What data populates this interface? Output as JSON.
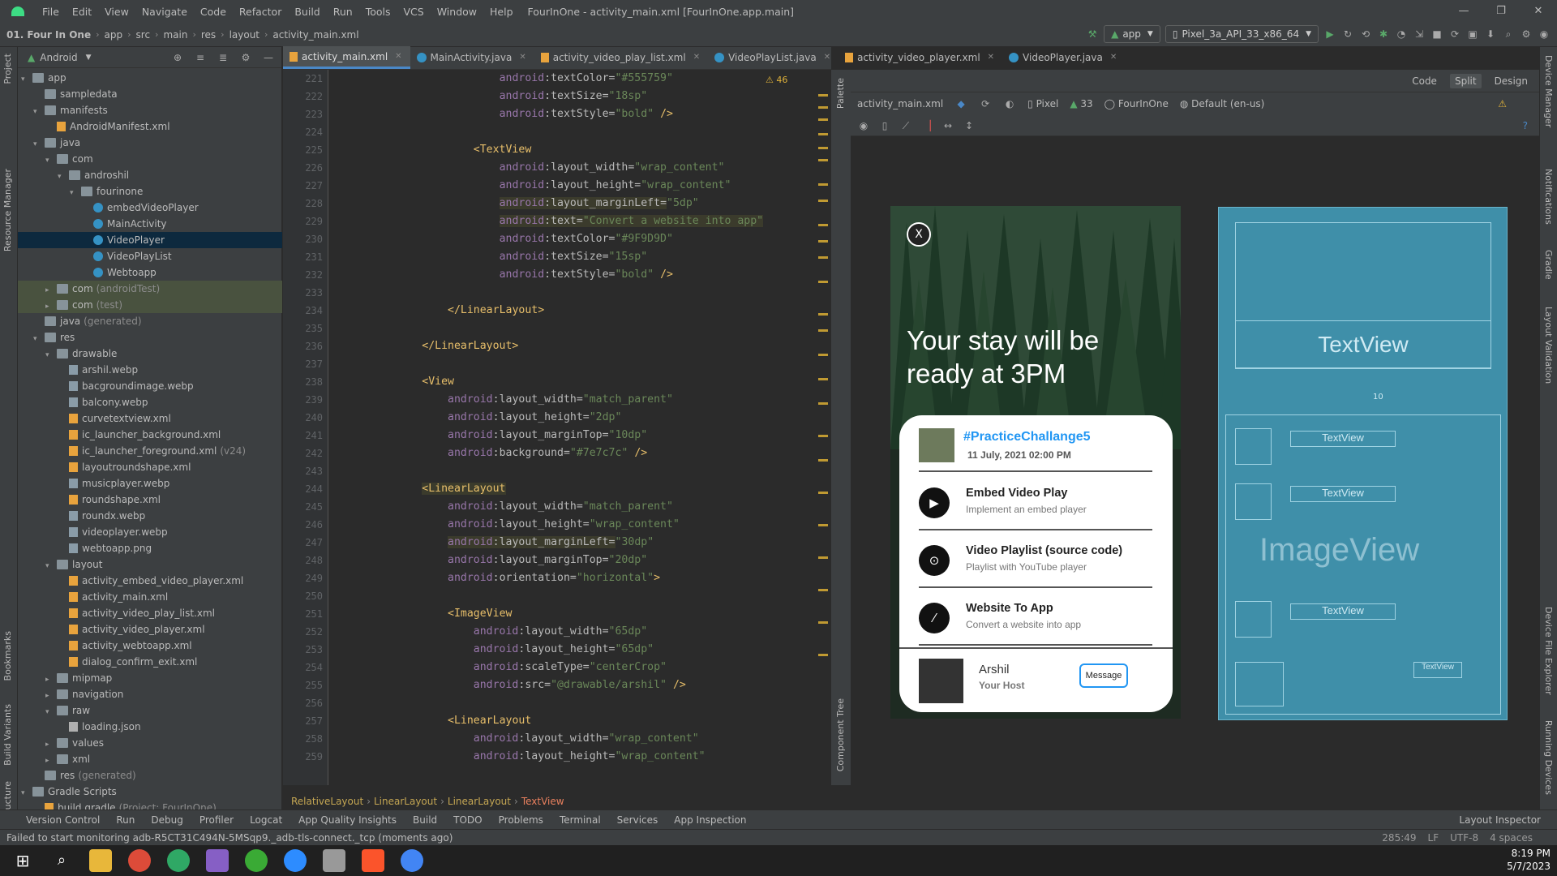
{
  "window": {
    "title": "FourInOne - activity_main.xml [FourInOne.app.main]",
    "menu": [
      "File",
      "Edit",
      "View",
      "Navigate",
      "Code",
      "Refactor",
      "Build",
      "Run",
      "Tools",
      "VCS",
      "Window",
      "Help"
    ],
    "buttons": [
      "—",
      "❐",
      "✕"
    ]
  },
  "nav": {
    "breadcrumb": [
      "01. Four In One",
      "app",
      "src",
      "main",
      "res",
      "layout",
      "activity_main.xml"
    ],
    "run_config": "app",
    "device": "Pixel_3a_API_33_x86_64"
  },
  "project": {
    "view": "Android",
    "tree": [
      {
        "label": "app",
        "depth": 0,
        "arrow": "down",
        "type": "folder"
      },
      {
        "label": "sampledata",
        "depth": 1,
        "arrow": "",
        "type": "folder"
      },
      {
        "label": "manifests",
        "depth": 1,
        "arrow": "down",
        "type": "folder"
      },
      {
        "label": "AndroidManifest.xml",
        "depth": 2,
        "arrow": "",
        "type": "xml"
      },
      {
        "label": "java",
        "depth": 1,
        "arrow": "down",
        "type": "folder"
      },
      {
        "label": "com",
        "depth": 2,
        "arrow": "down",
        "type": "folder"
      },
      {
        "label": "androshil",
        "depth": 3,
        "arrow": "down",
        "type": "folder"
      },
      {
        "label": "fourinone",
        "depth": 4,
        "arrow": "down",
        "type": "folder"
      },
      {
        "label": "embedVideoPlayer",
        "depth": 5,
        "arrow": "",
        "type": "class"
      },
      {
        "label": "MainActivity",
        "depth": 5,
        "arrow": "",
        "type": "class"
      },
      {
        "label": "VideoPlayer",
        "depth": 5,
        "arrow": "",
        "type": "class",
        "selected": true
      },
      {
        "label": "VideoPlayList",
        "depth": 5,
        "arrow": "",
        "type": "class"
      },
      {
        "label": "Webtoapp",
        "depth": 5,
        "arrow": "",
        "type": "class"
      },
      {
        "label": "com",
        "suffix": "(androidTest)",
        "depth": 2,
        "arrow": "right",
        "type": "folder",
        "gen": true
      },
      {
        "label": "com",
        "suffix": "(test)",
        "depth": 2,
        "arrow": "right",
        "type": "folder",
        "gen": true
      },
      {
        "label": "java",
        "suffix": "(generated)",
        "depth": 1,
        "arrow": "",
        "type": "folder"
      },
      {
        "label": "res",
        "depth": 1,
        "arrow": "down",
        "type": "folder"
      },
      {
        "label": "drawable",
        "depth": 2,
        "arrow": "down",
        "type": "folder"
      },
      {
        "label": "arshil.webp",
        "depth": 3,
        "arrow": "",
        "type": "img"
      },
      {
        "label": "bacgroundimage.webp",
        "depth": 3,
        "arrow": "",
        "type": "img"
      },
      {
        "label": "balcony.webp",
        "depth": 3,
        "arrow": "",
        "type": "img"
      },
      {
        "label": "curvetextview.xml",
        "depth": 3,
        "arrow": "",
        "type": "xml"
      },
      {
        "label": "ic_launcher_background.xml",
        "depth": 3,
        "arrow": "",
        "type": "xml"
      },
      {
        "label": "ic_launcher_foreground.xml",
        "suffix": "(v24)",
        "depth": 3,
        "arrow": "",
        "type": "xml"
      },
      {
        "label": "layoutroundshape.xml",
        "depth": 3,
        "arrow": "",
        "type": "xml"
      },
      {
        "label": "musicplayer.webp",
        "depth": 3,
        "arrow": "",
        "type": "img"
      },
      {
        "label": "roundshape.xml",
        "depth": 3,
        "arrow": "",
        "type": "xml"
      },
      {
        "label": "roundx.webp",
        "depth": 3,
        "arrow": "",
        "type": "img"
      },
      {
        "label": "videoplayer.webp",
        "depth": 3,
        "arrow": "",
        "type": "img"
      },
      {
        "label": "webtoapp.png",
        "depth": 3,
        "arrow": "",
        "type": "img"
      },
      {
        "label": "layout",
        "depth": 2,
        "arrow": "down",
        "type": "folder"
      },
      {
        "label": "activity_embed_video_player.xml",
        "depth": 3,
        "arrow": "",
        "type": "xml"
      },
      {
        "label": "activity_main.xml",
        "depth": 3,
        "arrow": "",
        "type": "xml"
      },
      {
        "label": "activity_video_play_list.xml",
        "depth": 3,
        "arrow": "",
        "type": "xml"
      },
      {
        "label": "activity_video_player.xml",
        "depth": 3,
        "arrow": "",
        "type": "xml"
      },
      {
        "label": "activity_webtoapp.xml",
        "depth": 3,
        "arrow": "",
        "type": "xml"
      },
      {
        "label": "dialog_confirm_exit.xml",
        "depth": 3,
        "arrow": "",
        "type": "xml"
      },
      {
        "label": "mipmap",
        "depth": 2,
        "arrow": "right",
        "type": "folder"
      },
      {
        "label": "navigation",
        "depth": 2,
        "arrow": "right",
        "type": "folder"
      },
      {
        "label": "raw",
        "depth": 2,
        "arrow": "down",
        "type": "folder"
      },
      {
        "label": "loading.json",
        "depth": 3,
        "arrow": "",
        "type": "json"
      },
      {
        "label": "values",
        "depth": 2,
        "arrow": "right",
        "type": "folder"
      },
      {
        "label": "xml",
        "depth": 2,
        "arrow": "right",
        "type": "folder"
      },
      {
        "label": "res",
        "suffix": "(generated)",
        "depth": 1,
        "arrow": "",
        "type": "folder"
      },
      {
        "label": "Gradle Scripts",
        "depth": 0,
        "arrow": "down",
        "type": "folder"
      },
      {
        "label": "build.gradle",
        "suffix": "(Project: FourInOne)",
        "depth": 1,
        "arrow": "",
        "type": "xml"
      }
    ]
  },
  "tabs": [
    {
      "label": "activity_main.xml",
      "kind": "xml",
      "active": true
    },
    {
      "label": "MainActivity.java",
      "kind": "class"
    },
    {
      "label": "activity_video_play_list.xml",
      "kind": "xml"
    },
    {
      "label": "VideoPlayList.java",
      "kind": "class"
    },
    {
      "label": "activity_video_player.xml",
      "kind": "xml"
    },
    {
      "label": "VideoPlayer.java",
      "kind": "class"
    }
  ],
  "editor": {
    "warning_count": "46",
    "lines": [
      {
        "n": "221",
        "indent": 6,
        "tokens": [
          [
            "ns",
            "android"
          ],
          [
            "at",
            ":textColor="
          ],
          [
            "str",
            "\"#555759\""
          ]
        ]
      },
      {
        "n": "222",
        "indent": 6,
        "tokens": [
          [
            "ns",
            "android"
          ],
          [
            "at",
            ":textSize="
          ],
          [
            "str",
            "\"18sp\""
          ]
        ]
      },
      {
        "n": "223",
        "indent": 6,
        "tokens": [
          [
            "ns",
            "android"
          ],
          [
            "at",
            ":textStyle="
          ],
          [
            "str",
            "\"bold\""
          ],
          [
            "tag",
            " />"
          ]
        ]
      },
      {
        "n": "224",
        "indent": 0,
        "tokens": []
      },
      {
        "n": "225",
        "indent": 5,
        "tokens": [
          [
            "tag",
            "<TextView"
          ]
        ]
      },
      {
        "n": "226",
        "indent": 6,
        "tokens": [
          [
            "ns",
            "android"
          ],
          [
            "at",
            ":layout_width="
          ],
          [
            "str",
            "\"wrap_content\""
          ]
        ]
      },
      {
        "n": "227",
        "indent": 6,
        "tokens": [
          [
            "ns",
            "android"
          ],
          [
            "at",
            ":layout_height="
          ],
          [
            "str",
            "\"wrap_content\""
          ]
        ]
      },
      {
        "n": "228",
        "indent": 6,
        "hl": true,
        "tokens": [
          [
            "ns",
            "android"
          ],
          [
            "at",
            ":layout_marginLeft"
          ],
          [
            "at",
            "="
          ],
          [
            "str",
            "\"5dp\""
          ]
        ]
      },
      {
        "n": "229",
        "indent": 6,
        "hl": true,
        "tokens": [
          [
            "ns",
            "android"
          ],
          [
            "at",
            ":text="
          ],
          [
            "str",
            "\"Convert a website into app\""
          ]
        ]
      },
      {
        "n": "230",
        "indent": 6,
        "tokens": [
          [
            "ns",
            "android"
          ],
          [
            "at",
            ":textColor="
          ],
          [
            "str",
            "\"#9F9D9D\""
          ]
        ]
      },
      {
        "n": "231",
        "indent": 6,
        "tokens": [
          [
            "ns",
            "android"
          ],
          [
            "at",
            ":textSize="
          ],
          [
            "str",
            "\"15sp\""
          ]
        ]
      },
      {
        "n": "232",
        "indent": 6,
        "tokens": [
          [
            "ns",
            "android"
          ],
          [
            "at",
            ":textStyle="
          ],
          [
            "str",
            "\"bold\""
          ],
          [
            "tag",
            " />"
          ]
        ]
      },
      {
        "n": "233",
        "indent": 0,
        "tokens": []
      },
      {
        "n": "234",
        "indent": 4,
        "tokens": [
          [
            "tag",
            "</LinearLayout>"
          ]
        ]
      },
      {
        "n": "235",
        "indent": 0,
        "tokens": []
      },
      {
        "n": "236",
        "indent": 3,
        "tokens": [
          [
            "tag",
            "</LinearLayout>"
          ]
        ]
      },
      {
        "n": "237",
        "indent": 0,
        "tokens": []
      },
      {
        "n": "238",
        "indent": 3,
        "tokens": [
          [
            "tag",
            "<View"
          ]
        ]
      },
      {
        "n": "239",
        "indent": 4,
        "tokens": [
          [
            "ns",
            "android"
          ],
          [
            "at",
            ":layout_width="
          ],
          [
            "str",
            "\"match_parent\""
          ]
        ]
      },
      {
        "n": "240",
        "indent": 4,
        "tokens": [
          [
            "ns",
            "android"
          ],
          [
            "at",
            ":layout_height="
          ],
          [
            "str",
            "\"2dp\""
          ]
        ]
      },
      {
        "n": "241",
        "indent": 4,
        "tokens": [
          [
            "ns",
            "android"
          ],
          [
            "at",
            ":layout_marginTop="
          ],
          [
            "str",
            "\"10dp\""
          ]
        ]
      },
      {
        "n": "242",
        "indent": 4,
        "tokens": [
          [
            "ns",
            "android"
          ],
          [
            "at",
            ":background="
          ],
          [
            "str",
            "\"#7e7c7c\""
          ],
          [
            "tag",
            " />"
          ]
        ]
      },
      {
        "n": "243",
        "indent": 0,
        "tokens": []
      },
      {
        "n": "244",
        "indent": 3,
        "hl": true,
        "tokens": [
          [
            "tag",
            "<LinearLayout"
          ]
        ]
      },
      {
        "n": "245",
        "indent": 4,
        "tokens": [
          [
            "ns",
            "android"
          ],
          [
            "at",
            ":layout_width="
          ],
          [
            "str",
            "\"match_parent\""
          ]
        ]
      },
      {
        "n": "246",
        "indent": 4,
        "tokens": [
          [
            "ns",
            "android"
          ],
          [
            "at",
            ":layout_height="
          ],
          [
            "str",
            "\"wrap_content\""
          ]
        ]
      },
      {
        "n": "247",
        "indent": 4,
        "hl": true,
        "tokens": [
          [
            "ns",
            "android"
          ],
          [
            "at",
            ":layout_marginLeft"
          ],
          [
            "at",
            "="
          ],
          [
            "str",
            "\"30dp\""
          ]
        ]
      },
      {
        "n": "248",
        "indent": 4,
        "tokens": [
          [
            "ns",
            "android"
          ],
          [
            "at",
            ":layout_marginTop="
          ],
          [
            "str",
            "\"20dp\""
          ]
        ]
      },
      {
        "n": "249",
        "indent": 4,
        "tokens": [
          [
            "ns",
            "android"
          ],
          [
            "at",
            ":orientation="
          ],
          [
            "str",
            "\"horizontal\""
          ],
          [
            "tag",
            ">"
          ]
        ]
      },
      {
        "n": "250",
        "indent": 0,
        "tokens": []
      },
      {
        "n": "251",
        "indent": 4,
        "tokens": [
          [
            "tag",
            "<ImageView"
          ]
        ]
      },
      {
        "n": "252",
        "indent": 5,
        "tokens": [
          [
            "ns",
            "android"
          ],
          [
            "at",
            ":layout_width="
          ],
          [
            "str",
            "\"65dp\""
          ]
        ]
      },
      {
        "n": "253",
        "indent": 5,
        "tokens": [
          [
            "ns",
            "android"
          ],
          [
            "at",
            ":layout_height="
          ],
          [
            "str",
            "\"65dp\""
          ]
        ]
      },
      {
        "n": "254",
        "indent": 5,
        "tokens": [
          [
            "ns",
            "android"
          ],
          [
            "at",
            ":scaleType="
          ],
          [
            "str",
            "\"centerCrop\""
          ]
        ]
      },
      {
        "n": "255",
        "indent": 5,
        "tokens": [
          [
            "ns",
            "android"
          ],
          [
            "at",
            ":src="
          ],
          [
            "str",
            "\"@drawable/arshil\""
          ],
          [
            "tag",
            " />"
          ]
        ]
      },
      {
        "n": "256",
        "indent": 0,
        "tokens": []
      },
      {
        "n": "257",
        "indent": 4,
        "tokens": [
          [
            "tag",
            "<LinearLayout"
          ]
        ]
      },
      {
        "n": "258",
        "indent": 5,
        "tokens": [
          [
            "ns",
            "android"
          ],
          [
            "at",
            ":layout_width="
          ],
          [
            "str",
            "\"wrap_content\""
          ]
        ]
      },
      {
        "n": "259",
        "indent": 5,
        "tokens": [
          [
            "ns",
            "android"
          ],
          [
            "at",
            ":layout_height="
          ],
          [
            "str",
            "\"wrap_content\""
          ]
        ]
      }
    ]
  },
  "design": {
    "modes": [
      "Code",
      "Split",
      "Design"
    ],
    "file": "activity_main.xml",
    "device": "Pixel",
    "api": "33",
    "theme": "FourInOne",
    "locale": "Default (en-us)",
    "palette": "Palette",
    "component_tree": "Component Tree",
    "preview": {
      "close": "X",
      "hero": "Your stay will be ready at 3PM",
      "post_title": "#PracticeChallange5",
      "post_date": "11 July, 2021 02:00 PM",
      "items": [
        {
          "title": "Embed Video Play",
          "sub": "Implement an embed player",
          "icon": "play-icon"
        },
        {
          "title": "Video Playlist (source code)",
          "sub": "Playlist with YouTube player",
          "icon": "play-outline-icon"
        },
        {
          "title": "Website To App",
          "sub": "Convert a website into app",
          "icon": "link-icon"
        }
      ],
      "host_name": "Arshil",
      "host_role": "Your Host",
      "message_button": "Message"
    },
    "blueprint": {
      "big_text": "TextView",
      "image_text": "ImageView",
      "small": "TextView",
      "view": "View",
      "spacing": "10"
    }
  },
  "bottom_crumbs": [
    "RelativeLayout",
    "LinearLayout",
    "LinearLayout",
    "TextView"
  ],
  "toolwindows": [
    "Version Control",
    "Run",
    "Debug",
    "Profiler",
    "Logcat",
    "App Quality Insights",
    "Build",
    "TODO",
    "Problems",
    "Terminal",
    "Services",
    "App Inspection",
    "Layout Inspector"
  ],
  "status": {
    "message": "Failed to start monitoring adb-R5CT31C494N-5MSqp9._adb-tls-connect._tcp (moments ago)",
    "position": "285:49",
    "line_sep": "LF",
    "encoding": "UTF-8",
    "indent": "4 spaces"
  },
  "clock": {
    "time": "8:19 PM",
    "date": "5/7/2023"
  },
  "side_tabs_left": [
    "Project",
    "Resource Manager",
    "Bookmarks",
    "Build Variants",
    "Structure"
  ],
  "side_tabs_right": [
    "Device Manager",
    "Notifications",
    "Gradle",
    "Layout Validation",
    "Device File Explorer",
    "Running Devices"
  ]
}
